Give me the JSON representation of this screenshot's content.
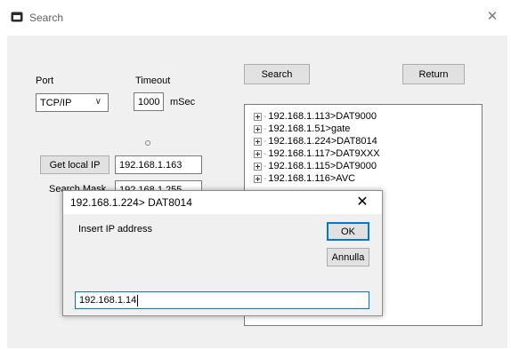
{
  "window": {
    "title": "Search",
    "close_glyph": "✕"
  },
  "form": {
    "port_label": "Port",
    "port_value": "TCP/IP",
    "timeout_label": "Timeout",
    "timeout_value": "1000",
    "timeout_unit": "mSec",
    "get_local_ip_label": "Get local IP",
    "local_ip_value": "192.168.1.163",
    "search_mask_label": "Search Mask",
    "search_mask_value": "192.168.1.255",
    "search_button_label": "Search",
    "return_button_label": "Return"
  },
  "tree": {
    "items": [
      {
        "label": "192.168.1.113>DAT9000"
      },
      {
        "label": "192.168.1.51>gate"
      },
      {
        "label": "192.168.1.224>DAT8014"
      },
      {
        "label": "192.168.1.117>DAT9XXX"
      },
      {
        "label": "192.168.1.115>DAT9000"
      },
      {
        "label": "192.168.1.116>AVC"
      }
    ]
  },
  "dialog": {
    "title": "192.168.1.224> DAT8014",
    "prompt": "Insert IP address",
    "ok_label": "OK",
    "cancel_label": "Annulla",
    "input_value": "192.168.1.14",
    "close_glyph": "✕"
  }
}
